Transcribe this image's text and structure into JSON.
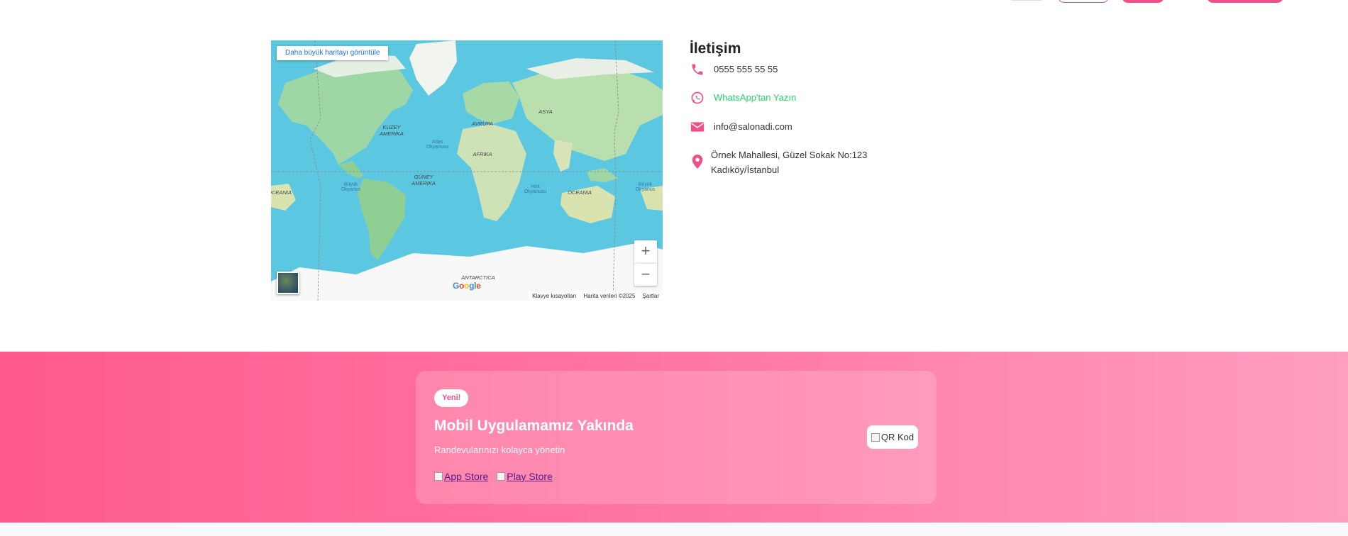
{
  "map": {
    "view_larger_link": "Daha büyük haritayı görüntüle",
    "zoom_in": "+",
    "zoom_out": "−",
    "labels": {
      "north_america": "KUZEY AMERİKA",
      "atlantic": "Atlas Okyanusu",
      "europe": "AVRUPA",
      "asia": "ASYA",
      "africa": "AFRİKA",
      "south_america": "GÜNEY AMERİKA",
      "pacific_left": "Büyük Okyanus",
      "pacific_right": "Büyük Okyanus",
      "indian": "Hint Okyanusu",
      "oceania_left": "OCEANIA",
      "oceania_right": "OCEANIA",
      "antarctica": "ANTARCTICA"
    },
    "google": "Google",
    "footer": {
      "shortcuts": "Klavye kısayolları",
      "map_data": "Harita verileri ©2025",
      "terms": "Şartlar"
    }
  },
  "contact": {
    "title": "İletişim",
    "phone": "0555 555 55 55",
    "whatsapp": "WhatsApp'tan Yazın",
    "email": "info@salonadi.com",
    "address_line1": "Örnek Mahallesi, Güzel Sokak No:123",
    "address_line2": "Kadıköy/İstanbul",
    "colors": {
      "accent": "#f0508a",
      "whatsapp": "#25d366"
    },
    "icons": [
      "phone-icon",
      "whatsapp-icon",
      "envelope-icon",
      "map-pin-icon"
    ]
  },
  "app_banner": {
    "badge": "Yeni!",
    "title": "Mobil Uygulamamız Yakında",
    "subtitle": "Randevularınızı kolayca yönetin",
    "app_store": "App Store",
    "play_store": "Play Store",
    "qr_alt": "QR Kod",
    "colors": {
      "gradient_start": "#ff5a8d",
      "gradient_end": "#ff9ec0"
    }
  }
}
